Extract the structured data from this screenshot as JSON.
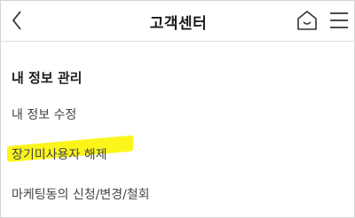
{
  "header": {
    "title": "고객센터",
    "back_icon": "chevron-left-icon",
    "home_icon": "home-icon",
    "menu_icon": "hamburger-menu-icon"
  },
  "section": {
    "title": "내 정보 관리"
  },
  "menu": {
    "items": [
      {
        "label": "내 정보 수정"
      },
      {
        "label": "장기미사용자 해제",
        "highlight_color": "#fbf51c"
      },
      {
        "label": "마케팅동의 신청/변경/철회"
      }
    ]
  }
}
